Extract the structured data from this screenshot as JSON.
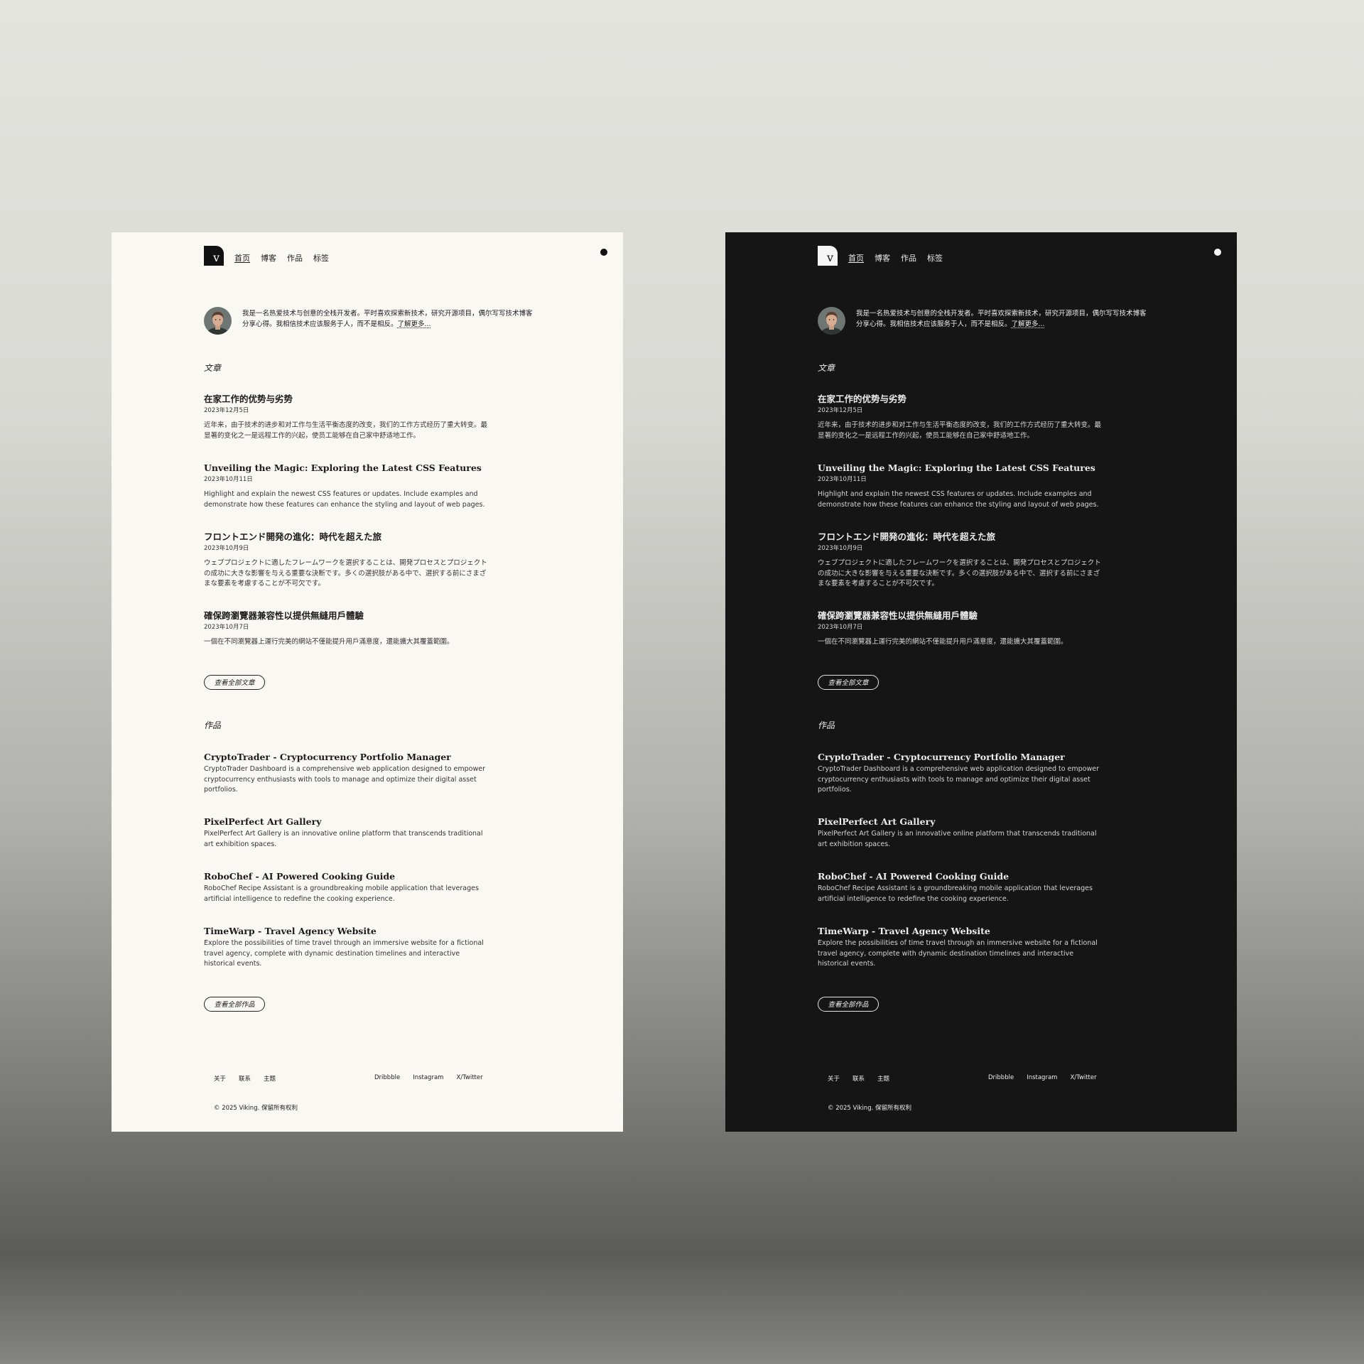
{
  "site": {
    "logo_letter": "v",
    "nav": [
      "首页",
      "博客",
      "作品",
      "标签"
    ]
  },
  "intro": {
    "text": "我是一名热爱技术与创意的全栈开发者。平时喜欢探索新技术，研究开源项目，偶尔写写技术博客分享心得。我相信技术应该服务于人，而不是相反。",
    "learn_more": "了解更多..."
  },
  "articles": {
    "heading": "文章",
    "items": [
      {
        "title": "在家工作的优势与劣势",
        "date": "2023年12月5日",
        "excerpt": "近年来，由于技术的进步和对工作与生活平衡态度的改变，我们的工作方式经历了重大转变。最显著的变化之一是远程工作的兴起，使员工能够在自己家中舒适地工作。"
      },
      {
        "title": "Unveiling the Magic: Exploring the Latest CSS Features",
        "date": "2023年10月11日",
        "excerpt": "Highlight and explain the newest CSS features or updates. Include examples and demonstrate how these features can enhance the styling and layout of web pages."
      },
      {
        "title": "フロントエンド開発の進化：時代を超えた旅",
        "date": "2023年10月9日",
        "excerpt": "ウェブプロジェクトに適したフレームワークを選択することは、開発プロセスとプロジェクトの成功に大きな影響を与える重要な決断です。多くの選択肢がある中で、選択する前にさまざまな要素を考慮することが不可欠です。"
      },
      {
        "title": "確保跨瀏覽器兼容性以提供無縫用戶體驗",
        "date": "2023年10月7日",
        "excerpt": "一個在不同瀏覽器上運行完美的網站不僅能提升用戶滿意度，還能擴大其覆蓋範圍。"
      }
    ],
    "view_all": "查看全部文章"
  },
  "projects": {
    "heading": "作品",
    "items": [
      {
        "title": "CryptoTrader - Cryptocurrency Portfolio Manager",
        "desc": "CryptoTrader Dashboard is a comprehensive web application designed to empower cryptocurrency enthusiasts with tools to manage and optimize their digital asset portfolios."
      },
      {
        "title": "PixelPerfect Art Gallery",
        "desc": "PixelPerfect Art Gallery is an innovative online platform that transcends traditional art exhibition spaces."
      },
      {
        "title": "RoboChef - AI Powered Cooking Guide",
        "desc": "RoboChef Recipe Assistant is a groundbreaking mobile application that leverages artificial intelligence to redefine the cooking experience."
      },
      {
        "title": "TimeWarp - Travel Agency Website",
        "desc": "Explore the possibilities of time travel through an immersive website for a fictional travel agency, complete with dynamic destination timelines and interactive historical events."
      }
    ],
    "view_all": "查看全部作品"
  },
  "footer": {
    "left_links": [
      "关于",
      "联系",
      "主题"
    ],
    "right_links": [
      "Dribbble",
      "Instagram",
      "X/Twitter"
    ],
    "copyright": "© 2025 Viking. 保留所有权利"
  },
  "colors": {
    "light_bg": "#f9f8f3",
    "dark_bg": "#151515",
    "backdrop_top": "#e4e4df",
    "backdrop_bottom": "#5b5b5a"
  },
  "icons": [
    "logo-v-icon",
    "theme-toggle-icon"
  ]
}
